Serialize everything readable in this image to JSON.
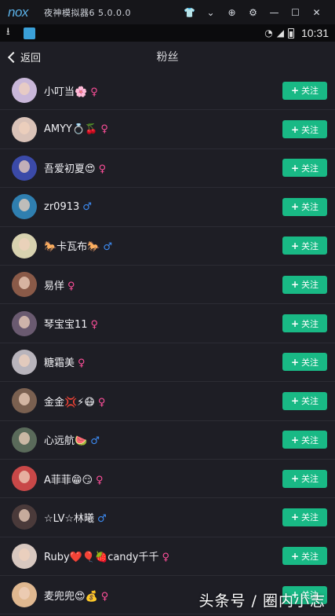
{
  "emulator": {
    "logo": "nox",
    "title": "夜神模拟器6 5.0.0.0",
    "controls": [
      "👕",
      "⌄",
      "⊕",
      "⚙",
      "—",
      "☐",
      "✕"
    ]
  },
  "status_bar": {
    "time": "10:31",
    "icons": [
      "download-icon",
      "app-icon",
      "wifi-icon",
      "signal-icon",
      "battery-icon"
    ]
  },
  "nav": {
    "back_label": "返回",
    "title": "粉丝"
  },
  "follow_label": "关注",
  "follow_plus": "+",
  "colors": {
    "follow_button": "#19b985",
    "female": "#ff4f9a",
    "male": "#3d8cf5",
    "row_bg": "#1e1e25",
    "divider": "#2c2c34"
  },
  "fans": [
    {
      "name": "小叮当🌸",
      "gender": "♀",
      "gender_type": "female",
      "avatar_color": "#c9b7d9"
    },
    {
      "name": "AMYY💍🍒",
      "gender": "♀",
      "gender_type": "female",
      "avatar_color": "#d9c2b8"
    },
    {
      "name": "吾爱初夏😍",
      "gender": "♀",
      "gender_type": "female",
      "avatar_color": "#3b4aa8"
    },
    {
      "name": "zr0913",
      "gender": "♂",
      "gender_type": "male",
      "avatar_color": "#2f7fb0"
    },
    {
      "name": "🐎卡瓦布🐎",
      "gender": "♂",
      "gender_type": "male",
      "avatar_color": "#d8d2b0"
    },
    {
      "name": "易佯",
      "gender": "♀",
      "gender_type": "female",
      "avatar_color": "#8a5a48"
    },
    {
      "name": "琴宝宝11",
      "gender": "♀",
      "gender_type": "female",
      "avatar_color": "#6a5a70"
    },
    {
      "name": "糖霜美",
      "gender": "♀",
      "gender_type": "female",
      "avatar_color": "#b8b4bc"
    },
    {
      "name": "金金💢⚡😷",
      "gender": "♀",
      "gender_type": "female",
      "avatar_color": "#7a6050"
    },
    {
      "name": "心远航🍉",
      "gender": "♂",
      "gender_type": "male",
      "avatar_color": "#5a6a5a"
    },
    {
      "name": "A菲菲😁😏",
      "gender": "♀",
      "gender_type": "female",
      "avatar_color": "#c84848"
    },
    {
      "name": "☆LV☆林曦",
      "gender": "♂",
      "gender_type": "male",
      "avatar_color": "#4a3a3a"
    },
    {
      "name": "Ruby❤️🎈🍓candy千千",
      "gender": "♀",
      "gender_type": "female",
      "avatar_color": "#d8c8c0"
    },
    {
      "name": "麦兜兜😍💰",
      "gender": "♀",
      "gender_type": "female",
      "avatar_color": "#e0b890"
    }
  ],
  "watermark": "头条号 / 圈内小志"
}
